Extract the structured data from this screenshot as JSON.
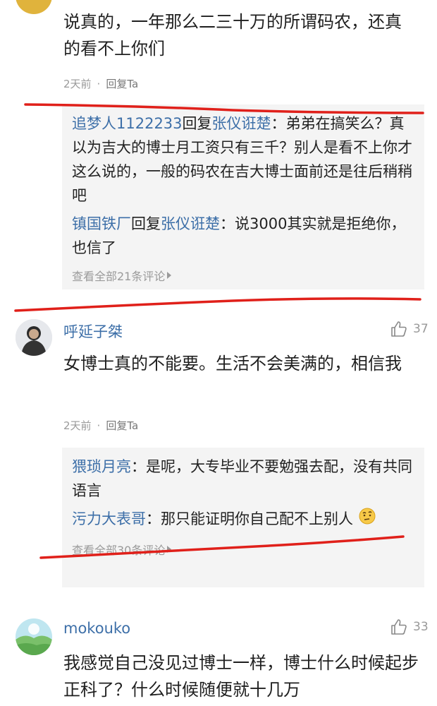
{
  "comments": [
    {
      "text": "说真的，一年那么二三十万的所谓码农，还真的看不上你们",
      "time": "2天前",
      "dot": "·",
      "reply_label": "回复Ta",
      "replies": [
        {
          "from": "追梦人1122233",
          "verb": "回复",
          "to": "张仪诳楚",
          "colon": "：",
          "text": "弟弟在搞笑么？真以为吉大的博士月工资只有三千？别人是看不上你才这么说的，一般的码农在吉大博士面前还是往后稍稍吧"
        },
        {
          "from": "镇国铁厂",
          "verb": "回复",
          "to": "张仪诳楚",
          "colon": "：",
          "text": "说3000其实就是拒绝你，也信了"
        }
      ],
      "view_all": "查看全部21条评论"
    },
    {
      "username": "呼延子桀",
      "likes": "37",
      "text": "女博士真的不能要。生活不会美满的，相信我",
      "time": "2天前",
      "dot": "·",
      "reply_label": "回复Ta",
      "replies": [
        {
          "from": "猥琐月亮",
          "colon": "：",
          "text": "是呢，大专毕业不要勉强去配，没有共同语言"
        },
        {
          "from": "污力大表哥",
          "colon": "：",
          "text": "那只能证明你自己配不上别人"
        }
      ],
      "view_all": "查看全部30条评论"
    },
    {
      "username": "mokouko",
      "likes": "33",
      "text": "我感觉自己没见过博士一样，博士什么时候起步正科了？什么时候随便就十几万"
    }
  ],
  "colors": {
    "username": "#3d6fa8",
    "annotation": "#e0201a",
    "reply_bg": "#f4f4f4"
  },
  "icons": [
    "thumb-up-icon",
    "chevron-right-icon",
    "thinking-emoji-icon",
    "avatar"
  ]
}
